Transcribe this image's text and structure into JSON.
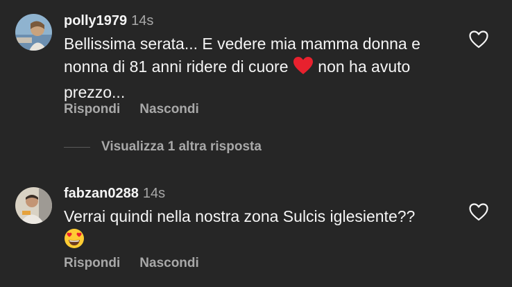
{
  "comments": [
    {
      "username": "polly1979",
      "time": "14s",
      "text_line1": "Bellissima serata... E vedere mia mamma donna e",
      "text_line2_a": "nonna di 81 anni ridere di cuore",
      "text_line2_b": "non ha avuto",
      "text_line3": "prezzo...",
      "emoji": "red-heart-emoji",
      "reply_label": "Rispondi",
      "hide_label": "Nascondi",
      "view_replies_label": "Visualizza 1 altra risposta"
    },
    {
      "username": "fabzan0288",
      "time": "14s",
      "text_line1": "Verrai quindi nella nostra zona Sulcis iglesiente??",
      "emoji": "heart-eyes-emoji",
      "reply_label": "Rispondi",
      "hide_label": "Nascondi"
    }
  ],
  "icons": {
    "like": "heart-outline-icon"
  },
  "colors": {
    "background": "#262626",
    "primary_text": "#f5f5f5",
    "secondary_text": "#a8a8a8",
    "heart_red": "#e8212e",
    "emoji_yellow": "#ffcc33"
  }
}
